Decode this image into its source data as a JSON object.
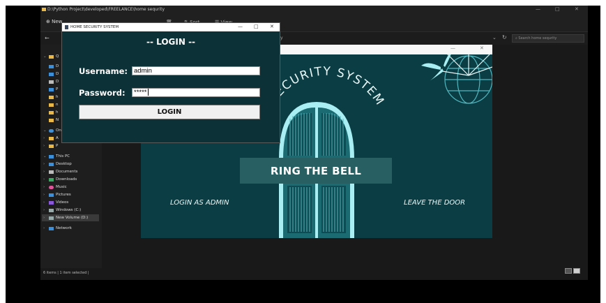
{
  "explorer": {
    "path": "D:\\Python Project\\developed\\FREELANCE\\home sequrity",
    "new_label": "New",
    "sort_label": "Sort",
    "view_label": "View",
    "more_label": "...",
    "address_text": "y",
    "search_placeholder": "Search home sequrity",
    "sidebar": {
      "this_pc": "This PC",
      "desktop": "Desktop",
      "documents": "Documents",
      "downloads": "Downloads",
      "music": "Music",
      "pictures": "Pictures",
      "videos": "Videos",
      "windows_c": "Windows (C:)",
      "new_volume": "New Volume (D:)",
      "network": "Network"
    },
    "status": "6 items  |  1 item selected  |"
  },
  "security_app": {
    "arc_text": "SECURITY SYSTEM",
    "ring_bell": "RING THE BELL",
    "login_admin": "LOGIN AS ADMIN",
    "leave_door": "LEAVE THE DOOR"
  },
  "login_window": {
    "title": "HOME SECURITY SYSTEM",
    "heading": "-- LOGIN --",
    "username_label": "Username:",
    "username_value": "admin",
    "password_label": "Password:",
    "password_value": "*****",
    "login_button": "LOGIN"
  },
  "colors": {
    "app_bg": "#0b3e44",
    "door": "#a8eef2",
    "bell_banner": "#275f62",
    "login_bg": "#0c3137"
  }
}
